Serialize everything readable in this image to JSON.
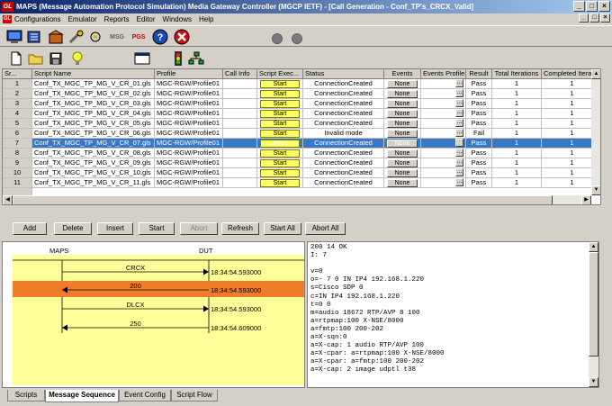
{
  "title": "MAPS (Message Automation Protocol Simulation) Media Gateway Controller (MGCP IETF) - [Call Generation - Conf_TP's_CRCX_Valid]",
  "title_logo": "GL",
  "window_buttons": [
    "_",
    "□",
    "×"
  ],
  "mdi_buttons": [
    "_",
    "□",
    "×"
  ],
  "menu": [
    "Configurations",
    "Emulator",
    "Reports",
    "Editor",
    "Windows",
    "Help"
  ],
  "toolbar": {
    "msg_label": "MSG",
    "pgs_label": "PGS",
    "help_label": "?"
  },
  "grid": {
    "columns": [
      "Sr...",
      "Script Name",
      "Profile",
      "Call Info",
      "Script Exec...",
      "Status",
      "Events",
      "Events Profile",
      "Result",
      "Total Iterations",
      "Completed Iterations"
    ],
    "rows": [
      {
        "sr": "1",
        "script": "Conf_TX_MGC_TP_MG_V_CR_01.gls",
        "profile": "MGC-RGW/Profile01",
        "exec": "Start",
        "status": "ConnectionCreated",
        "events": "None",
        "result": "Pass",
        "total": "1",
        "completed": "1"
      },
      {
        "sr": "2",
        "script": "Conf_TX_MGC_TP_MG_V_CR_02.gls",
        "profile": "MGC-RGW/Profile01",
        "exec": "Start",
        "status": "ConnectionCreated",
        "events": "None",
        "result": "Pass",
        "total": "1",
        "completed": "1"
      },
      {
        "sr": "3",
        "script": "Conf_TX_MGC_TP_MG_V_CR_03.gls",
        "profile": "MGC-RGW/Profile01",
        "exec": "Start",
        "status": "ConnectionCreated",
        "events": "None",
        "result": "Pass",
        "total": "1",
        "completed": "1"
      },
      {
        "sr": "4",
        "script": "Conf_TX_MGC_TP_MG_V_CR_04.gls",
        "profile": "MGC-RGW/Profile01",
        "exec": "Start",
        "status": "ConnectionCreated",
        "events": "None",
        "result": "Pass",
        "total": "1",
        "completed": "1"
      },
      {
        "sr": "5",
        "script": "Conf_TX_MGC_TP_MG_V_CR_05.gls",
        "profile": "MGC-RGW/Profile01",
        "exec": "Start",
        "status": "ConnectionCreated",
        "events": "None",
        "result": "Pass",
        "total": "1",
        "completed": "1"
      },
      {
        "sr": "6",
        "script": "Conf_TX_MGC_TP_MG_V_CR_06.gls",
        "profile": "MGC-RGW/Profile01",
        "exec": "Start",
        "status": "Invalid mode",
        "events": "None",
        "result": "Fail",
        "total": "1",
        "completed": "1"
      },
      {
        "sr": "7",
        "script": "Conf_TX_MGC_TP_MG_V_CR_07.gls",
        "profile": "MGC-RGW/Profile01",
        "exec": "Start",
        "status": "ConnectionCreated",
        "events": "None",
        "result": "Pass",
        "total": "1",
        "completed": "1"
      },
      {
        "sr": "8",
        "script": "Conf_TX_MGC_TP_MG_V_CR_08.gls",
        "profile": "MGC-RGW/Profile01",
        "exec": "Start",
        "status": "ConnectionCreated",
        "events": "None",
        "result": "Pass",
        "total": "1",
        "completed": "1"
      },
      {
        "sr": "9",
        "script": "Conf_TX_MGC_TP_MG_V_CR_09.gls",
        "profile": "MGC-RGW/Profile01",
        "exec": "Start",
        "status": "ConnectionCreated",
        "events": "None",
        "result": "Pass",
        "total": "1",
        "completed": "1"
      },
      {
        "sr": "10",
        "script": "Conf_TX_MGC_TP_MG_V_CR_10.gls",
        "profile": "MGC-RGW/Profile01",
        "exec": "Start",
        "status": "ConnectionCreated",
        "events": "None",
        "result": "Pass",
        "total": "1",
        "completed": "1"
      },
      {
        "sr": "11",
        "script": "Conf_TX_MGC_TP_MG_V_CR_11.gls",
        "profile": "MGC-RGW/Profile01",
        "exec": "Start",
        "status": "ConnectionCreated",
        "events": "None",
        "result": "Pass",
        "total": "1",
        "completed": "1"
      }
    ],
    "selected_row": 6
  },
  "buttons": [
    "Add",
    "Delete",
    "Insert",
    "Start",
    "Abort",
    "Refresh",
    "Start All",
    "Abort All"
  ],
  "sequence": {
    "left_label": "MAPS",
    "right_label": "DUT",
    "messages": [
      {
        "label": "CRCX",
        "time": "18:34:54.593000",
        "direction": "right",
        "highlight": false
      },
      {
        "label": "200",
        "time": "18:34:54.593000",
        "direction": "left",
        "highlight": true
      },
      {
        "label": "DLCX",
        "time": "18:34:54.593000",
        "direction": "right",
        "highlight": false
      },
      {
        "label": "250",
        "time": "18:34:54.609000",
        "direction": "left",
        "highlight": false
      }
    ],
    "highlight_color": "#f07c2a"
  },
  "message_text": "200 14 OK\nI: 7\n\nv=0\no=- 7 0 IN IP4 192.168.1.220\ns=Cisco SDP 0\nc=IN IP4 192.168.1.220\nt=0 0\nm=audio 18672 RTP/AVP 8 100\na=rtpmap:100 X-NSE/8000\na=fmtp:100 200-202\na=X-sqn:0\na=X-cap: 1 audio RTP/AVP 100\na=X-cpar: a=rtpmap:100 X-NSE/8000\na=X-cpar: a=fmtp:100 200-202\na=X-cap: 2 image udptl t38",
  "tabs": [
    "Scripts",
    "Message Sequence",
    "Event Config",
    "Script Flow"
  ],
  "active_tab": 1
}
